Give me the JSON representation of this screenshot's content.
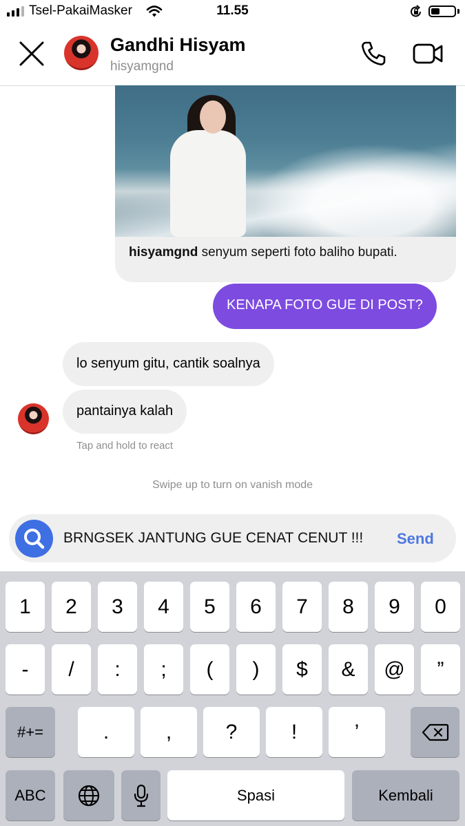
{
  "status_bar": {
    "carrier": "Tsel-PakaiMasker",
    "time": "11.55"
  },
  "header": {
    "name": "Gandhi Hisyam",
    "username": "hisyamgnd"
  },
  "post": {
    "caption_user": "hisyamgnd",
    "caption_text": "senyum seperti foto baliho bupati."
  },
  "messages": {
    "sent": "KENAPA FOTO GUE DI POST?",
    "received": [
      "lo senyum gitu, cantik soalnya",
      "pantainya kalah"
    ]
  },
  "hints": {
    "react": "Tap and hold to react",
    "vanish": "Swipe up to turn on vanish mode"
  },
  "composer": {
    "text": "BRNGSEK JANTUNG GUE CENAT CENUT !!!",
    "send_label": "Send"
  },
  "keyboard": {
    "row1": [
      "1",
      "2",
      "3",
      "4",
      "5",
      "6",
      "7",
      "8",
      "9",
      "0"
    ],
    "row2": [
      "-",
      "/",
      ":",
      ";",
      "(",
      ")",
      "$",
      "&",
      "@",
      "”"
    ],
    "row3": [
      ".",
      ",",
      "?",
      "!",
      "’"
    ],
    "symbols_label": "#+=",
    "abc_label": "ABC",
    "space_label": "Spasi",
    "return_label": "Kembali"
  },
  "colors": {
    "sent_bubble": "#7d4be0",
    "send_button": "#4e78e0",
    "camera_button": "#3e6fe3"
  },
  "icons": [
    "signal-icon",
    "wifi-icon",
    "orientation-lock-icon",
    "battery-icon",
    "close-icon",
    "phone-icon",
    "video-call-icon",
    "search-icon",
    "globe-icon",
    "microphone-icon",
    "backspace-icon"
  ]
}
